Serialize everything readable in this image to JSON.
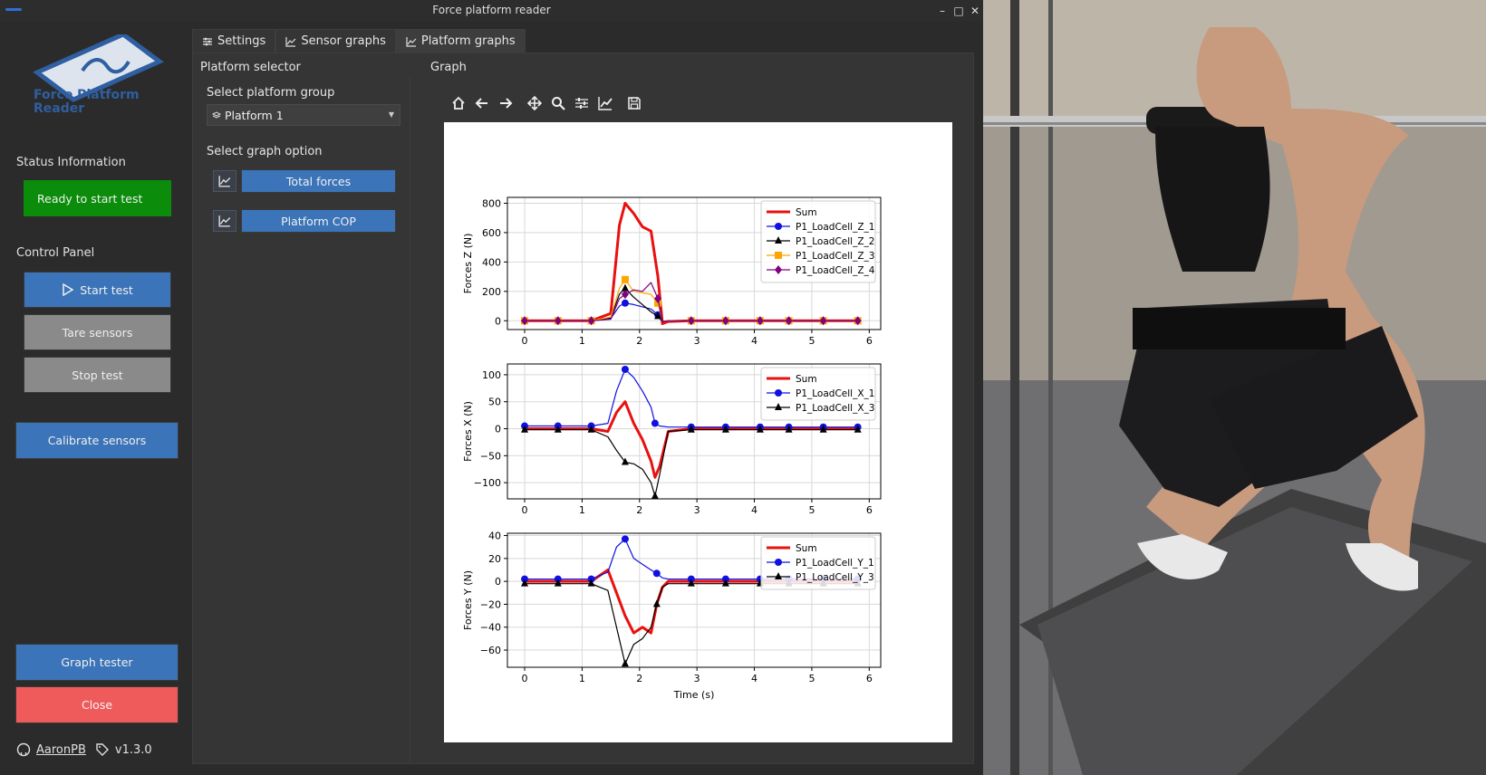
{
  "window": {
    "title": "Force platform reader"
  },
  "sidebar": {
    "logo_line1": "Force Platform",
    "logo_line2": "Reader",
    "status_heading": "Status Information",
    "status_text": "Ready to start test",
    "control_heading": "Control Panel",
    "start_label": "Start test",
    "tare_label": "Tare sensors",
    "stop_label": "Stop test",
    "calibrate_label": "Calibrate sensors",
    "graph_tester_label": "Graph tester",
    "close_label": "Close",
    "author": "AaronPB",
    "version": "v1.3.0"
  },
  "tabs": [
    {
      "label": "Settings"
    },
    {
      "label": "Sensor graphs"
    },
    {
      "label": "Platform graphs"
    }
  ],
  "platform_selector": {
    "heading": "Platform selector",
    "group_label": "Select platform group",
    "group_value": "Platform 1",
    "option_label": "Select graph option",
    "total_forces_label": "Total forces",
    "cop_label": "Platform COP"
  },
  "graph": {
    "heading": "Graph"
  },
  "colors": {
    "sum": "#e81010",
    "lc1": "#1010e0",
    "lc2": "#000000",
    "lc3": "#ffa500",
    "lc4": "#800080",
    "accent": "#3b74b8",
    "status_ok": "#0b8c0b",
    "danger": "#ef5a5a"
  },
  "chart_data": [
    {
      "type": "line",
      "ylabel": "Forces Z (N)",
      "xlim": [
        -0.3,
        6.2
      ],
      "ylim": [
        -60,
        840
      ],
      "xticks": [
        0,
        1,
        2,
        3,
        4,
        5,
        6
      ],
      "yticks": [
        0,
        200,
        400,
        600,
        800
      ],
      "legend": "top-right",
      "grid": true,
      "x": [
        0,
        0.58,
        1.16,
        1.5,
        1.65,
        1.75,
        1.9,
        2.05,
        2.2,
        2.32,
        2.4,
        2.5,
        2.9,
        3.5,
        4.1,
        4.6,
        5.2,
        5.8
      ],
      "series": [
        {
          "name": "Sum",
          "marker": "none",
          "color": "#e81010",
          "values": [
            0,
            0,
            0,
            50,
            650,
            800,
            730,
            640,
            610,
            300,
            -20,
            -5,
            0,
            0,
            0,
            0,
            0,
            0
          ]
        },
        {
          "name": "P1_LoadCell_Z_1",
          "marker": "circle",
          "color": "#1010e0",
          "values": [
            0,
            0,
            0,
            15,
            100,
            120,
            110,
            95,
            80,
            40,
            -5,
            0,
            0,
            0,
            0,
            0,
            0,
            0
          ]
        },
        {
          "name": "P1_LoadCell_Z_2",
          "marker": "triangle",
          "color": "#000000",
          "values": [
            0,
            0,
            0,
            20,
            180,
            220,
            160,
            110,
            60,
            30,
            -5,
            0,
            0,
            0,
            0,
            0,
            0,
            0
          ]
        },
        {
          "name": "P1_LoadCell_Z_3",
          "marker": "square",
          "color": "#ffa500",
          "values": [
            0,
            0,
            0,
            25,
            220,
            280,
            200,
            190,
            180,
            120,
            -5,
            0,
            0,
            0,
            0,
            0,
            0,
            0
          ]
        },
        {
          "name": "P1_LoadCell_Z_4",
          "marker": "diamond",
          "color": "#800080",
          "values": [
            0,
            0,
            0,
            10,
            150,
            180,
            210,
            200,
            260,
            150,
            -5,
            0,
            0,
            0,
            0,
            0,
            0,
            0
          ]
        }
      ]
    },
    {
      "type": "line",
      "ylabel": "Forces X (N)",
      "xlim": [
        -0.3,
        6.2
      ],
      "ylim": [
        -130,
        120
      ],
      "xticks": [
        0,
        1,
        2,
        3,
        4,
        5,
        6
      ],
      "yticks": [
        -100,
        -50,
        0,
        50,
        100
      ],
      "legend": "top-right",
      "grid": true,
      "x": [
        0,
        0.58,
        1.16,
        1.45,
        1.6,
        1.75,
        1.9,
        2.05,
        2.2,
        2.27,
        2.35,
        2.5,
        2.9,
        3.5,
        4.1,
        4.6,
        5.2,
        5.8
      ],
      "series": [
        {
          "name": "Sum",
          "marker": "none",
          "color": "#e81010",
          "values": [
            0,
            0,
            0,
            -5,
            30,
            50,
            10,
            -20,
            -60,
            -90,
            -70,
            -5,
            0,
            0,
            0,
            0,
            0,
            0
          ]
        },
        {
          "name": "P1_LoadCell_X_1",
          "marker": "circle",
          "color": "#1010e0",
          "values": [
            5,
            5,
            5,
            10,
            70,
            110,
            95,
            70,
            40,
            10,
            5,
            3,
            3,
            3,
            3,
            3,
            3,
            3
          ]
        },
        {
          "name": "P1_LoadCell_X_3",
          "marker": "triangle",
          "color": "#000000",
          "values": [
            -2,
            -2,
            -2,
            -15,
            -40,
            -62,
            -65,
            -75,
            -100,
            -125,
            -85,
            -5,
            -2,
            -2,
            -2,
            -2,
            -2,
            -2
          ]
        }
      ]
    },
    {
      "type": "line",
      "ylabel": "Forces Y (N)",
      "xlabel": "Time (s)",
      "xlim": [
        -0.3,
        6.2
      ],
      "ylim": [
        -75,
        42
      ],
      "xticks": [
        0,
        1,
        2,
        3,
        4,
        5,
        6
      ],
      "yticks": [
        -60,
        -40,
        -20,
        0,
        20,
        40
      ],
      "legend": "top-right",
      "grid": true,
      "x": [
        0,
        0.58,
        1.16,
        1.45,
        1.6,
        1.75,
        1.9,
        2.05,
        2.2,
        2.3,
        2.4,
        2.5,
        2.9,
        3.5,
        4.1,
        4.6,
        5.2,
        5.8
      ],
      "series": [
        {
          "name": "Sum",
          "marker": "none",
          "color": "#e81010",
          "values": [
            0,
            0,
            0,
            10,
            -10,
            -30,
            -45,
            -40,
            -45,
            -20,
            -5,
            0,
            0,
            0,
            0,
            0,
            0,
            0
          ]
        },
        {
          "name": "P1_LoadCell_Y_1",
          "marker": "circle",
          "color": "#1010e0",
          "values": [
            2,
            2,
            2,
            8,
            30,
            37,
            20,
            15,
            10,
            7,
            3,
            2,
            2,
            2,
            2,
            2,
            2,
            2
          ]
        },
        {
          "name": "P1_LoadCell_Y_3",
          "marker": "triangle",
          "color": "#000000",
          "values": [
            -2,
            -2,
            -2,
            -8,
            -40,
            -72,
            -55,
            -50,
            -40,
            -20,
            -5,
            -2,
            -2,
            -2,
            -2,
            -2,
            -2,
            -2
          ]
        }
      ]
    }
  ]
}
